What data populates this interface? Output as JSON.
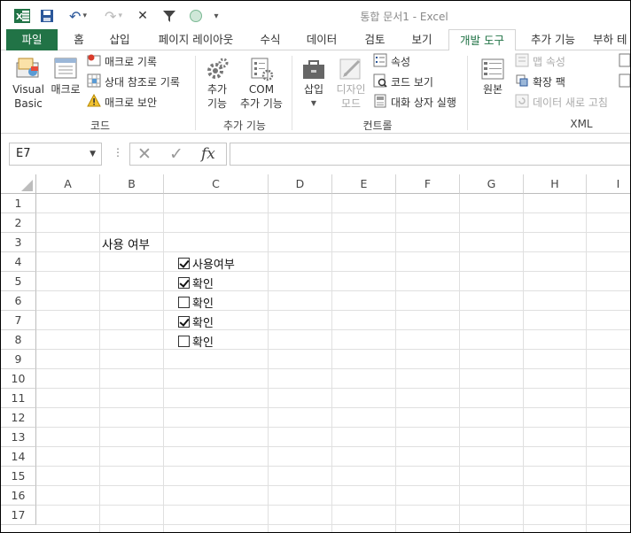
{
  "window": {
    "title": "통합 문서1 - Excel"
  },
  "quick_access": {
    "undo": "↶",
    "redo": "↷",
    "close_x": "✕",
    "more": "▾"
  },
  "tabs": [
    "파일",
    "홈",
    "삽입",
    "페이지 레이아웃",
    "수식",
    "데이터",
    "검토",
    "보기",
    "개발 도구",
    "추가 기능",
    "부하 테"
  ],
  "active_tab": "개발 도구",
  "ribbon": {
    "code": {
      "label": "코드",
      "visual_basic": [
        "Visual",
        "Basic"
      ],
      "macro": "매크로",
      "record_macro": "매크로 기록",
      "relative_ref": "상대 참조로 기록",
      "macro_security": "매크로 보안"
    },
    "addins": {
      "label": "추가 기능",
      "addins_btn": [
        "추가",
        "기능"
      ],
      "com_addins": [
        "COM",
        "추가 기능"
      ]
    },
    "controls": {
      "label": "컨트롤",
      "insert": "삽입",
      "design_mode": [
        "디자인",
        "모드"
      ],
      "properties": "속성",
      "view_code": "코드 보기",
      "run_dialog": "대화 상자 실행"
    },
    "xml": {
      "label": "XML",
      "source": "원본",
      "map_properties": "맵 속성",
      "expansion_packs": "확장 팩",
      "refresh_data": "데이터 새로 고침"
    }
  },
  "formula_bar": {
    "name_box": "E7",
    "cancel": "✕",
    "enter": "✓",
    "fx": "fx",
    "formula": ""
  },
  "sheet": {
    "columns": [
      "A",
      "B",
      "C",
      "D",
      "E",
      "F",
      "G",
      "H",
      "I"
    ],
    "rows": [
      "1",
      "2",
      "3",
      "4",
      "5",
      "6",
      "7",
      "8",
      "9",
      "10",
      "11",
      "12",
      "13",
      "14",
      "15",
      "16",
      "17"
    ],
    "cells": {
      "B3": "사용 여부"
    },
    "checkboxes": [
      {
        "label": "사용여부",
        "checked": true
      },
      {
        "label": "확인",
        "checked": true
      },
      {
        "label": "확인",
        "checked": false
      },
      {
        "label": "확인",
        "checked": true
      },
      {
        "label": "확인",
        "checked": false
      }
    ]
  },
  "colors": {
    "excel_green": "#217346",
    "ribbon_border": "#d4d4d4"
  }
}
